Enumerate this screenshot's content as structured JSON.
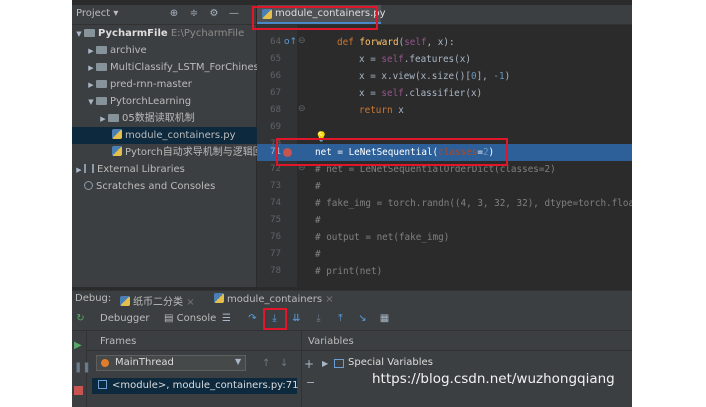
{
  "project_panel": {
    "title": "Project",
    "tree": [
      {
        "label": "PycharmFile",
        "path": "E:\\PycharmFile",
        "type": "root"
      },
      {
        "label": "archive",
        "type": "folder"
      },
      {
        "label": "MultiClassify_LSTM_ForChinese",
        "type": "folder"
      },
      {
        "label": "pred-rnn-master",
        "type": "folder"
      },
      {
        "label": "PytorchLearning",
        "type": "folder-open"
      },
      {
        "label": "05数据读取机制",
        "type": "folder"
      },
      {
        "label": "module_containers.py",
        "type": "py-file"
      },
      {
        "label": "Pytorch自动求导机制与逻辑回归",
        "type": "py-file"
      },
      {
        "label": "External Libraries",
        "type": "lib"
      },
      {
        "label": "Scratches and Consoles",
        "type": "scratch"
      }
    ]
  },
  "editor": {
    "tab_label": "module_containers.py",
    "lines": [
      {
        "num": "64",
        "code": "def forward(self, x):"
      },
      {
        "num": "65",
        "code": "x = self.features(x)"
      },
      {
        "num": "66",
        "code": "x = x.view(x.size()[0], -1)"
      },
      {
        "num": "67",
        "code": "x = self.classifier(x)"
      },
      {
        "num": "68",
        "code": "return x"
      },
      {
        "num": "69",
        "code": ""
      },
      {
        "num": "70",
        "code": ""
      },
      {
        "num": "71",
        "code": "net = LeNetSequential(classes=2)"
      },
      {
        "num": "72",
        "code": "# net = LeNetSequentialOrderDict(classes=2)"
      },
      {
        "num": "73",
        "code": "#"
      },
      {
        "num": "74",
        "code": "# fake_img = torch.randn((4, 3, 32, 32), dtype=torch.float32)"
      },
      {
        "num": "75",
        "code": "#"
      },
      {
        "num": "76",
        "code": "# output = net(fake_img)"
      },
      {
        "num": "77",
        "code": "#"
      },
      {
        "num": "78",
        "code": "# print(net)"
      }
    ]
  },
  "debug": {
    "label": "Debug:",
    "tabs": [
      "纸币二分类",
      "module_containers"
    ],
    "toolbar": {
      "debugger": "Debugger",
      "console": "Console"
    },
    "frames_header": "Frames",
    "variables_header": "Variables",
    "thread": "MainThread",
    "frame": "<module>, module_containers.py:71",
    "special_variables": "Special Variables"
  },
  "watermark": "https://blog.csdn.net/wuzhongqiang",
  "colors": {
    "accent": "#2d6099",
    "highlight_box": "#e0162b",
    "breakpoint": "#c75450"
  }
}
